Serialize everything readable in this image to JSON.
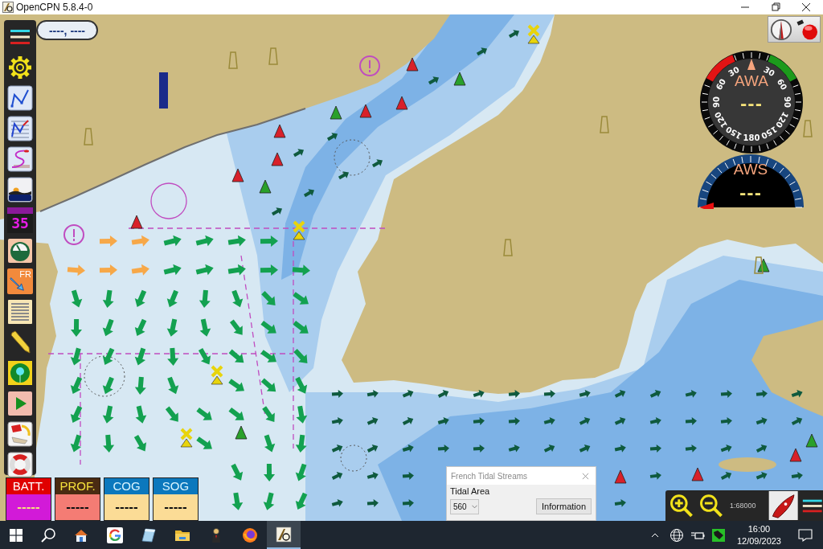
{
  "window": {
    "title": "OpenCPN 5.8.4-0"
  },
  "position_display": {
    "value": "----, ----"
  },
  "toolbar": [
    {
      "kind": "menu"
    },
    {
      "kind": "settings"
    },
    {
      "kind": "route"
    },
    {
      "kind": "track"
    },
    {
      "kind": "curve"
    },
    {
      "kind": "sunset"
    },
    {
      "kind": "digits",
      "label": "35"
    },
    {
      "kind": "gauge"
    },
    {
      "kind": "tides",
      "label": "FR"
    },
    {
      "kind": "list"
    },
    {
      "kind": "pencil"
    },
    {
      "kind": "target"
    },
    {
      "kind": "play"
    },
    {
      "kind": "memo"
    },
    {
      "kind": "lifebuoy"
    }
  ],
  "gauges": [
    {
      "kind": "angle",
      "title": "AWA",
      "value": "---",
      "left_scale": [
        "30",
        "60",
        "90",
        "120",
        "150"
      ],
      "right_scale": [
        "30",
        "60",
        "90",
        "120",
        "150"
      ],
      "bottom_label": "180"
    },
    {
      "kind": "speed",
      "title": "AWS",
      "value": "---",
      "level": 0
    }
  ],
  "data_boxes": [
    {
      "kind": "battery",
      "caption": "BATT.",
      "value": "-----"
    },
    {
      "kind": "depth",
      "caption": "PROF.",
      "value": "-----"
    },
    {
      "kind": "course",
      "caption": "COG",
      "value": "-----"
    },
    {
      "kind": "speed",
      "caption": "SOG",
      "value": "-----"
    }
  ],
  "tidal_dialog": {
    "title": "French Tidal Streams",
    "area_label": "Tidal Area",
    "area_select": "560",
    "button": "Information"
  },
  "chart_controls": {
    "scale": "1:68000"
  },
  "taskbar": {
    "apps": [
      {
        "kind": "house",
        "selected": false
      },
      {
        "kind": "letter",
        "selected": false
      },
      {
        "kind": "notepad",
        "selected": false
      },
      {
        "kind": "folder",
        "selected": false
      },
      {
        "kind": "figure",
        "selected": false
      },
      {
        "kind": "browser",
        "selected": false
      },
      {
        "kind": "chart",
        "selected": true
      }
    ],
    "time": "16:00",
    "date": "12/09/2023"
  }
}
